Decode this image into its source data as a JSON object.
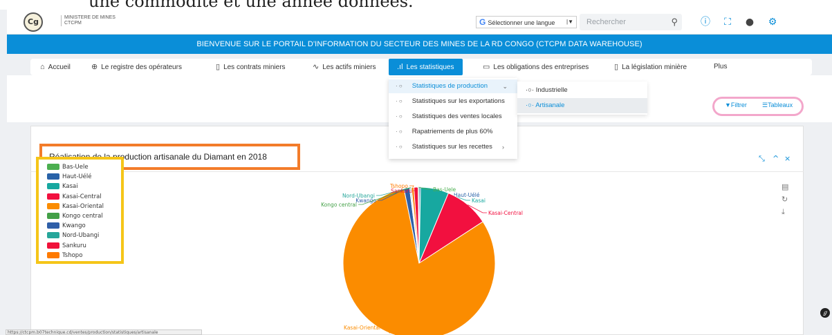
{
  "doc_fragment": "une commodité et une année données.",
  "header": {
    "logo_text": "Cg",
    "org_line1": "MINISTERE DE MINES",
    "org_line2": "CTCPM",
    "language_label": "Sélectionner une langue",
    "language_sep": "|▼",
    "search_placeholder": "Rechercher"
  },
  "banner": "BIENVENUE SUR LE PORTAIL D'INFORMATION DU SECTEUR DES MINES DE LA RD CONGO (CTCPM DATA WAREHOUSE)",
  "nav": {
    "accueil": "Accueil",
    "registre": "Le registre des opérateurs",
    "contrats": "Les contrats miniers",
    "actifs": "Les actifs miniers",
    "statistiques": "Les statistiques",
    "obligations": "Les obligations des entreprises",
    "legislation": "La législation minière",
    "plus": "Plus"
  },
  "dropdown": {
    "production": "Statistiques de production",
    "exportations": "Statistiques sur les exportations",
    "ventes": "Statistiques des ventes locales",
    "rapatriements": "Rapatriements de plus 60%",
    "recettes": "Statistiques sur les recettes"
  },
  "submenu": {
    "industrielle": "Industrielle",
    "artisanale": "Artisanale"
  },
  "toolbar": {
    "filtrer": "Filtrer",
    "tableaux": "Tableaux"
  },
  "chart_card": {
    "title": "Réalisation de la production artisanale du Diamant en 2018"
  },
  "status_url": "https://ctcpm.b07technique.cd/ventes/production/statistiques/artisanale",
  "chart_data": {
    "type": "pie",
    "title": "Réalisation de la production artisanale du Diamant en 2018",
    "legend_placement": "top-left",
    "categories": [
      "Bas-Uele",
      "Haut-Uélé",
      "Kasai",
      "Kasai-Central",
      "Kasai-Oriental",
      "Kongo central",
      "Kwango",
      "Nord-Ubangi",
      "Sankuru",
      "Tshopo"
    ],
    "values": [
      0.2,
      0.3,
      6.0,
      9.5,
      81.0,
      0.2,
      1.2,
      0.2,
      0.9,
      0.5
    ],
    "colors": [
      "#4caf50",
      "#2962a8",
      "#17a8a0",
      "#f2103f",
      "#fb8c00",
      "#43a047",
      "#2f5fa8",
      "#26a69a",
      "#f0123a",
      "#ff7a00"
    ]
  }
}
